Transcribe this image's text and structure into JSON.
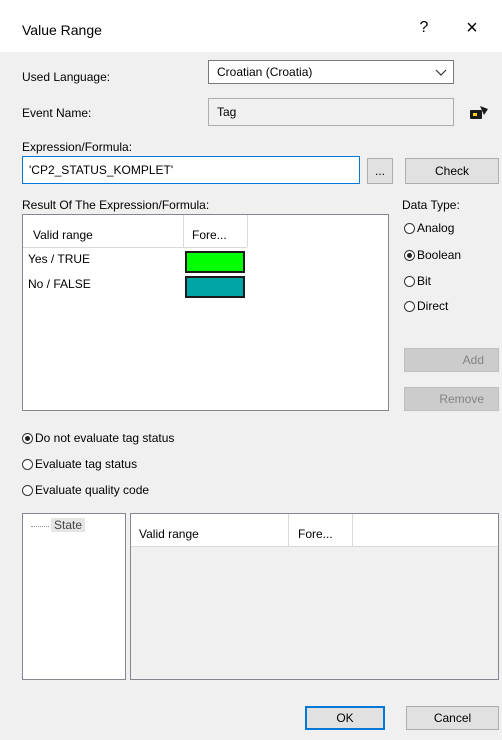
{
  "window": {
    "title": "Value Range",
    "help_glyph": "?",
    "close_glyph": "×"
  },
  "used_language": {
    "label": "Used Language:",
    "value": "Croatian (Croatia)"
  },
  "event_name": {
    "label": "Event Name:",
    "value": "Tag",
    "icon": "tag-picker-icon"
  },
  "expression": {
    "label": "Expression/Formula:",
    "value": "'CP2_STATUS_KOMPLET'",
    "browse_label": "...",
    "check_label": "Check"
  },
  "result": {
    "label": "Result Of The Expression/Formula:",
    "columns": [
      "Valid range",
      "Fore..."
    ],
    "rows": [
      {
        "range": "Yes / TRUE",
        "color": "#00ff00"
      },
      {
        "range": "No / FALSE",
        "color": "#00a6a6"
      }
    ]
  },
  "data_type": {
    "label": "Data Type:",
    "options": [
      "Analog",
      "Boolean",
      "Bit",
      "Direct"
    ],
    "selected": "Boolean"
  },
  "side_buttons": {
    "add": "Add",
    "remove": "Remove"
  },
  "tag_status": {
    "options": [
      "Do not evaluate tag status",
      "Evaluate tag status",
      "Evaluate quality code"
    ],
    "selected": "Do not evaluate tag status"
  },
  "state_tree": {
    "item": "State"
  },
  "state_grid": {
    "columns": [
      "Valid range",
      "Fore..."
    ]
  },
  "footer": {
    "ok": "OK",
    "cancel": "Cancel"
  }
}
